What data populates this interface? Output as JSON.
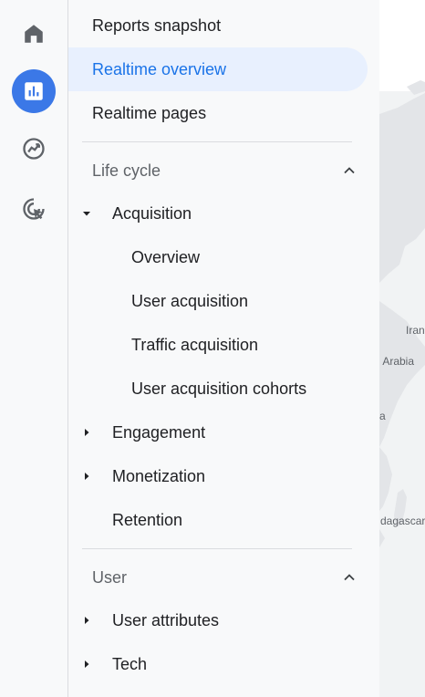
{
  "rail": {
    "items": [
      {
        "icon": "home-icon"
      },
      {
        "icon": "reports-icon",
        "active": true
      },
      {
        "icon": "explore-icon"
      },
      {
        "icon": "advertising-icon"
      }
    ]
  },
  "nav": {
    "reports_snapshot": "Reports snapshot",
    "realtime_overview": "Realtime overview",
    "realtime_pages": "Realtime pages",
    "life_cycle": {
      "label": "Life cycle",
      "acquisition": "Acquisition",
      "acquisition_items": [
        "Overview",
        "User acquisition",
        "Traffic acquisition",
        "User acquisition cohorts"
      ],
      "engagement": "Engagement",
      "monetization": "Monetization",
      "retention": "Retention"
    },
    "user": {
      "label": "User",
      "user_attributes": "User attributes",
      "tech": "Tech"
    }
  },
  "map": {
    "labels": [
      "Iran",
      "i Arabia",
      "a",
      "dagascar"
    ]
  },
  "colors": {
    "accent": "#1a73e8",
    "active_bg": "#e8f0fe",
    "rail_active": "#3b78e7"
  }
}
